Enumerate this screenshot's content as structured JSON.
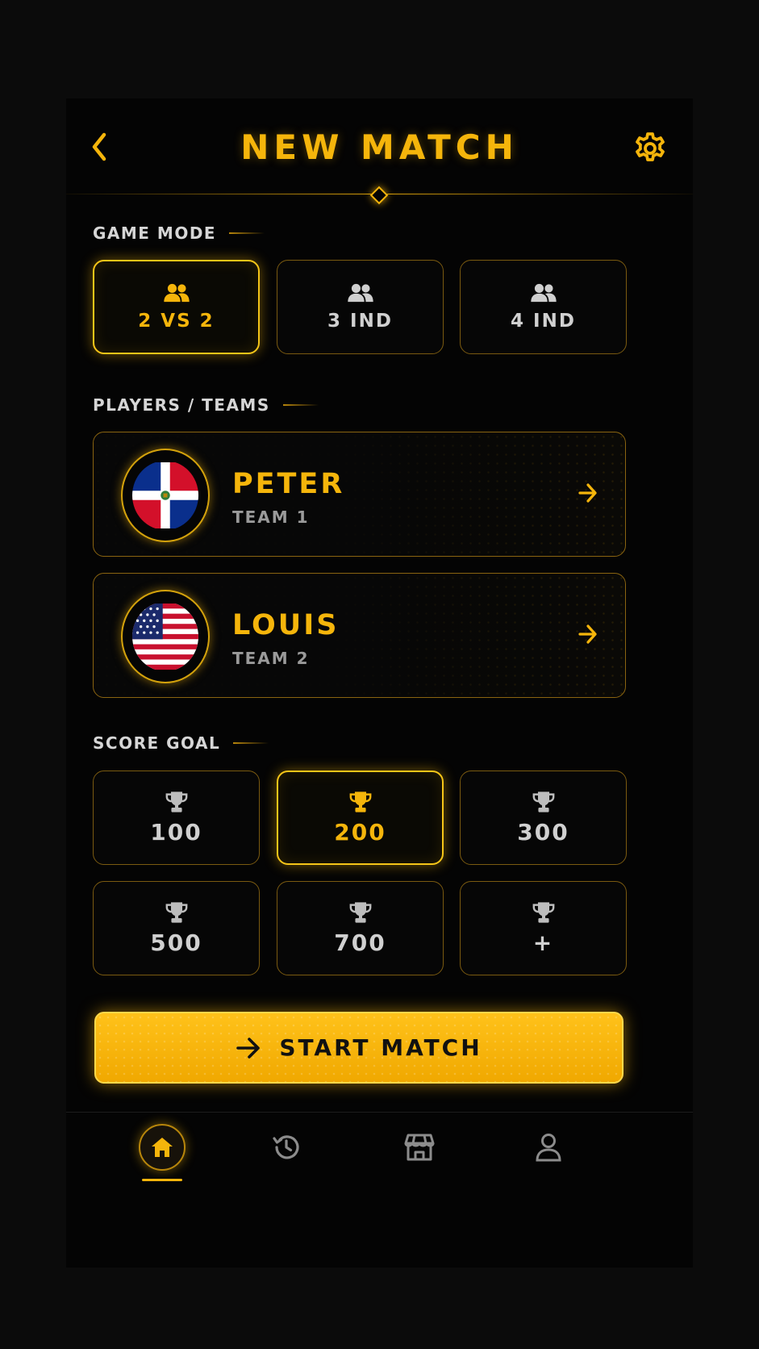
{
  "header": {
    "title": "NEW MATCH",
    "back_icon": "chevron-left-icon",
    "settings_icon": "gear-icon"
  },
  "game_mode": {
    "label": "GAME MODE",
    "options": [
      {
        "label": "2 VS 2",
        "icon": "users-icon",
        "selected": true
      },
      {
        "label": "3 IND",
        "icon": "users-icon",
        "selected": false
      },
      {
        "label": "4 IND",
        "icon": "users-icon",
        "selected": false
      }
    ]
  },
  "players": {
    "label": "PLAYERS / TEAMS",
    "items": [
      {
        "name": "PETER",
        "team": "TEAM 1",
        "flag": "dominican-republic-flag"
      },
      {
        "name": "LOUIS",
        "team": "TEAM 2",
        "flag": "usa-flag"
      }
    ]
  },
  "score_goal": {
    "label": "SCORE GOAL",
    "options": [
      {
        "label": "100",
        "selected": false
      },
      {
        "label": "200",
        "selected": true
      },
      {
        "label": "300",
        "selected": false
      },
      {
        "label": "500",
        "selected": false
      },
      {
        "label": "700",
        "selected": false
      },
      {
        "label": "+",
        "selected": false
      }
    ]
  },
  "start_button": {
    "label": "START MATCH",
    "icon": "arrow-right-icon"
  },
  "bottom_nav": [
    {
      "icon": "home-icon",
      "active": true
    },
    {
      "icon": "history-icon",
      "active": false
    },
    {
      "icon": "store-icon",
      "active": false
    },
    {
      "icon": "profile-icon",
      "active": false
    }
  ],
  "colors": {
    "accent": "#f5b50b",
    "background": "#040404",
    "muted": "#9a9a9a"
  }
}
